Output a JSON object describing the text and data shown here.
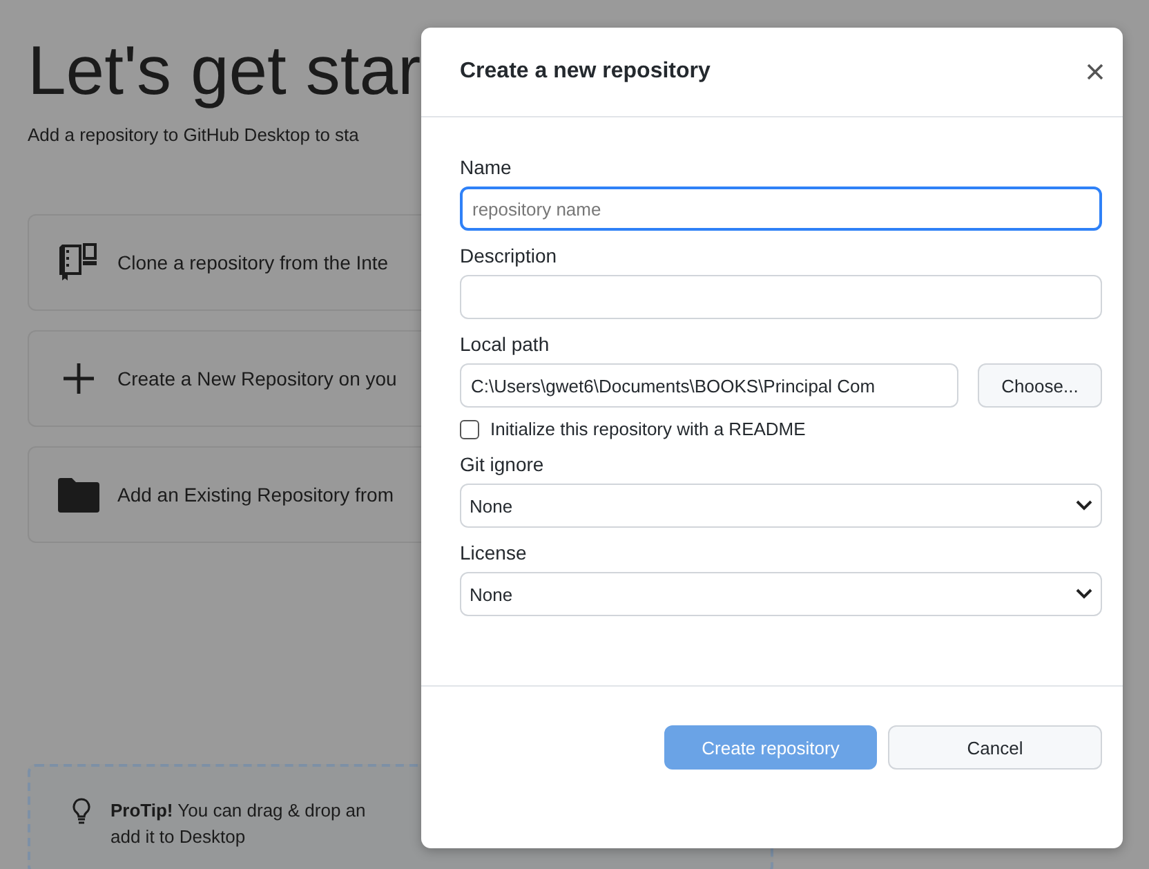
{
  "background": {
    "title": "Let's get star",
    "subtitle": "Add a repository to GitHub Desktop to sta",
    "options": [
      {
        "kind": "clone",
        "label": "Clone a repository from the Inte"
      },
      {
        "kind": "create",
        "label": "Create a New Repository on you"
      },
      {
        "kind": "add",
        "label": "Add an Existing Repository from"
      }
    ],
    "protip": {
      "text": "**ProTip!** You can drag & drop an",
      "text_2": "add it to Desktop"
    }
  },
  "dialog": {
    "title": "Create a new repository",
    "fields": [
      {
        "kind": "text",
        "label": "Name",
        "placeholder": "repository name",
        "focused": true
      },
      {
        "kind": "text",
        "label": "Description",
        "focused": false
      },
      {
        "kind": "path",
        "label": "Local path",
        "value": "C:\\Users\\gwet6\\Documents\\BOOKS\\Principal Com",
        "button": "Choose..."
      },
      {
        "kind": "checkbox",
        "label": "Initialize this repository with a README",
        "checked": false
      },
      {
        "kind": "select",
        "label": "Git ignore",
        "value": "None"
      },
      {
        "kind": "select",
        "label": "License",
        "value": "None"
      }
    ],
    "buttons": [
      {
        "kind": "primary",
        "label": "Create repository",
        "disabled": true
      },
      {
        "kind": "secondary",
        "label": "Cancel",
        "disabled": false
      }
    ]
  }
}
